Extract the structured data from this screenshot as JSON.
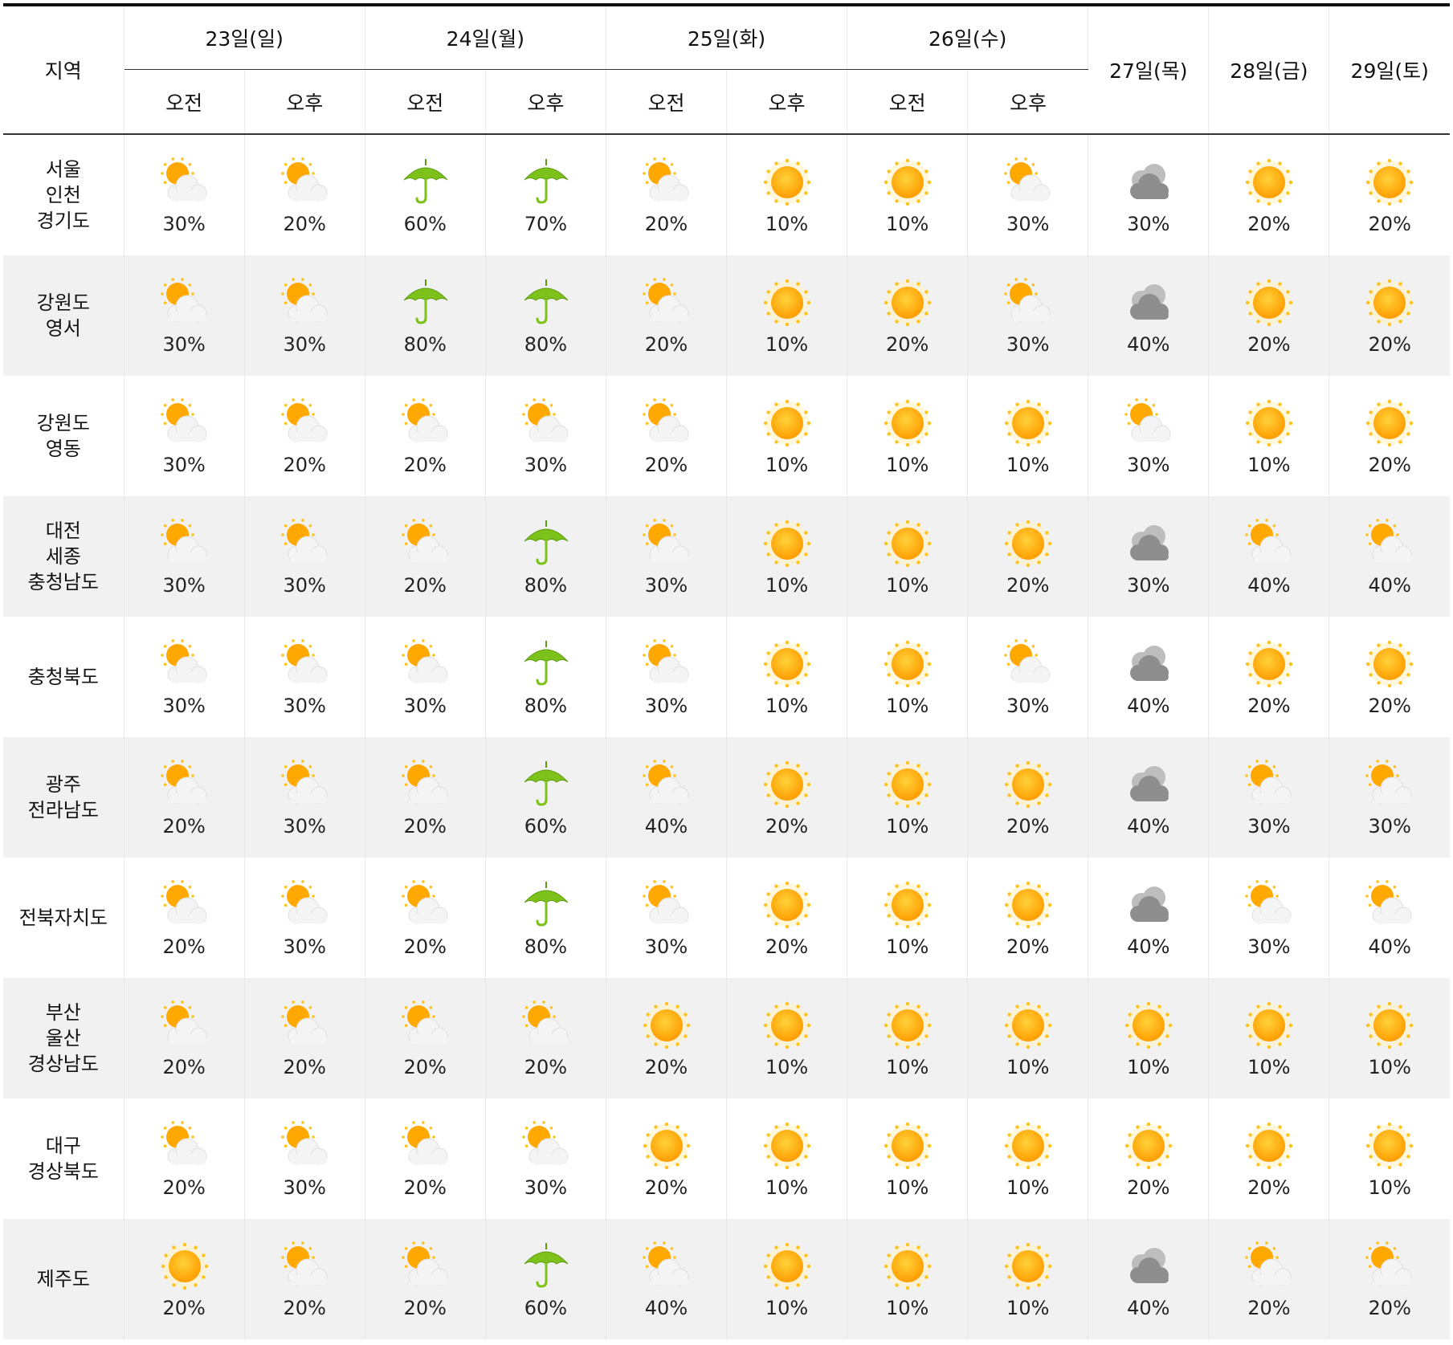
{
  "header": {
    "region_label": "지역",
    "days": [
      {
        "label": "23일(일)",
        "split": true
      },
      {
        "label": "24일(월)",
        "split": true
      },
      {
        "label": "25일(화)",
        "split": true
      },
      {
        "label": "26일(수)",
        "split": true
      },
      {
        "label": "27일(목)",
        "split": false
      },
      {
        "label": "28일(금)",
        "split": false
      },
      {
        "label": "29일(토)",
        "split": false
      }
    ],
    "am_label": "오전",
    "pm_label": "오후"
  },
  "icon_names": {
    "partly": "partly-cloudy-icon",
    "sun": "sun-icon",
    "umbrella": "umbrella-icon",
    "cloud": "cloudy-icon"
  },
  "colors": {
    "sun": "#ffa800",
    "umbrella": "#7cc21a",
    "cloud": "#9a9a9a",
    "alt_row": "#f1f1f1"
  },
  "rows": [
    {
      "region": [
        "서울",
        "인천",
        "경기도"
      ],
      "cells": [
        {
          "icon": "partly",
          "pct": "30%"
        },
        {
          "icon": "partly",
          "pct": "20%"
        },
        {
          "icon": "umbrella",
          "pct": "60%"
        },
        {
          "icon": "umbrella",
          "pct": "70%"
        },
        {
          "icon": "partly",
          "pct": "20%"
        },
        {
          "icon": "sun",
          "pct": "10%"
        },
        {
          "icon": "sun",
          "pct": "10%"
        },
        {
          "icon": "partly",
          "pct": "30%"
        },
        {
          "icon": "cloud",
          "pct": "30%"
        },
        {
          "icon": "sun",
          "pct": "20%"
        },
        {
          "icon": "sun",
          "pct": "20%"
        }
      ]
    },
    {
      "region": [
        "강원도",
        "영서"
      ],
      "cells": [
        {
          "icon": "partly",
          "pct": "30%"
        },
        {
          "icon": "partly",
          "pct": "30%"
        },
        {
          "icon": "umbrella",
          "pct": "80%"
        },
        {
          "icon": "umbrella",
          "pct": "80%"
        },
        {
          "icon": "partly",
          "pct": "20%"
        },
        {
          "icon": "sun",
          "pct": "10%"
        },
        {
          "icon": "sun",
          "pct": "20%"
        },
        {
          "icon": "partly",
          "pct": "30%"
        },
        {
          "icon": "cloud",
          "pct": "40%"
        },
        {
          "icon": "sun",
          "pct": "20%"
        },
        {
          "icon": "sun",
          "pct": "20%"
        }
      ]
    },
    {
      "region": [
        "강원도",
        "영동"
      ],
      "cells": [
        {
          "icon": "partly",
          "pct": "30%"
        },
        {
          "icon": "partly",
          "pct": "20%"
        },
        {
          "icon": "partly",
          "pct": "20%"
        },
        {
          "icon": "partly",
          "pct": "30%"
        },
        {
          "icon": "partly",
          "pct": "20%"
        },
        {
          "icon": "sun",
          "pct": "10%"
        },
        {
          "icon": "sun",
          "pct": "10%"
        },
        {
          "icon": "sun",
          "pct": "10%"
        },
        {
          "icon": "partly",
          "pct": "30%"
        },
        {
          "icon": "sun",
          "pct": "10%"
        },
        {
          "icon": "sun",
          "pct": "20%"
        }
      ]
    },
    {
      "region": [
        "대전",
        "세종",
        "충청남도"
      ],
      "cells": [
        {
          "icon": "partly",
          "pct": "30%"
        },
        {
          "icon": "partly",
          "pct": "30%"
        },
        {
          "icon": "partly",
          "pct": "20%"
        },
        {
          "icon": "umbrella",
          "pct": "80%"
        },
        {
          "icon": "partly",
          "pct": "30%"
        },
        {
          "icon": "sun",
          "pct": "10%"
        },
        {
          "icon": "sun",
          "pct": "10%"
        },
        {
          "icon": "sun",
          "pct": "20%"
        },
        {
          "icon": "cloud",
          "pct": "30%"
        },
        {
          "icon": "partly",
          "pct": "40%"
        },
        {
          "icon": "partly",
          "pct": "40%"
        }
      ]
    },
    {
      "region": [
        "충청북도"
      ],
      "cells": [
        {
          "icon": "partly",
          "pct": "30%"
        },
        {
          "icon": "partly",
          "pct": "30%"
        },
        {
          "icon": "partly",
          "pct": "30%"
        },
        {
          "icon": "umbrella",
          "pct": "80%"
        },
        {
          "icon": "partly",
          "pct": "30%"
        },
        {
          "icon": "sun",
          "pct": "10%"
        },
        {
          "icon": "sun",
          "pct": "10%"
        },
        {
          "icon": "partly",
          "pct": "30%"
        },
        {
          "icon": "cloud",
          "pct": "40%"
        },
        {
          "icon": "sun",
          "pct": "20%"
        },
        {
          "icon": "sun",
          "pct": "20%"
        }
      ]
    },
    {
      "region": [
        "광주",
        "전라남도"
      ],
      "cells": [
        {
          "icon": "partly",
          "pct": "20%"
        },
        {
          "icon": "partly",
          "pct": "30%"
        },
        {
          "icon": "partly",
          "pct": "20%"
        },
        {
          "icon": "umbrella",
          "pct": "60%"
        },
        {
          "icon": "partly",
          "pct": "40%"
        },
        {
          "icon": "sun",
          "pct": "20%"
        },
        {
          "icon": "sun",
          "pct": "10%"
        },
        {
          "icon": "sun",
          "pct": "20%"
        },
        {
          "icon": "cloud",
          "pct": "40%"
        },
        {
          "icon": "partly",
          "pct": "30%"
        },
        {
          "icon": "partly",
          "pct": "30%"
        }
      ]
    },
    {
      "region": [
        "전북자치도"
      ],
      "cells": [
        {
          "icon": "partly",
          "pct": "20%"
        },
        {
          "icon": "partly",
          "pct": "30%"
        },
        {
          "icon": "partly",
          "pct": "20%"
        },
        {
          "icon": "umbrella",
          "pct": "80%"
        },
        {
          "icon": "partly",
          "pct": "30%"
        },
        {
          "icon": "sun",
          "pct": "20%"
        },
        {
          "icon": "sun",
          "pct": "10%"
        },
        {
          "icon": "sun",
          "pct": "20%"
        },
        {
          "icon": "cloud",
          "pct": "40%"
        },
        {
          "icon": "partly",
          "pct": "30%"
        },
        {
          "icon": "partly",
          "pct": "40%"
        }
      ]
    },
    {
      "region": [
        "부산",
        "울산",
        "경상남도"
      ],
      "cells": [
        {
          "icon": "partly",
          "pct": "20%"
        },
        {
          "icon": "partly",
          "pct": "20%"
        },
        {
          "icon": "partly",
          "pct": "20%"
        },
        {
          "icon": "partly",
          "pct": "20%"
        },
        {
          "icon": "sun",
          "pct": "20%"
        },
        {
          "icon": "sun",
          "pct": "10%"
        },
        {
          "icon": "sun",
          "pct": "10%"
        },
        {
          "icon": "sun",
          "pct": "10%"
        },
        {
          "icon": "sun",
          "pct": "10%"
        },
        {
          "icon": "sun",
          "pct": "10%"
        },
        {
          "icon": "sun",
          "pct": "10%"
        }
      ]
    },
    {
      "region": [
        "대구",
        "경상북도"
      ],
      "cells": [
        {
          "icon": "partly",
          "pct": "20%"
        },
        {
          "icon": "partly",
          "pct": "30%"
        },
        {
          "icon": "partly",
          "pct": "20%"
        },
        {
          "icon": "partly",
          "pct": "30%"
        },
        {
          "icon": "sun",
          "pct": "20%"
        },
        {
          "icon": "sun",
          "pct": "10%"
        },
        {
          "icon": "sun",
          "pct": "10%"
        },
        {
          "icon": "sun",
          "pct": "10%"
        },
        {
          "icon": "sun",
          "pct": "20%"
        },
        {
          "icon": "sun",
          "pct": "20%"
        },
        {
          "icon": "sun",
          "pct": "10%"
        }
      ]
    },
    {
      "region": [
        "제주도"
      ],
      "cells": [
        {
          "icon": "sun",
          "pct": "20%"
        },
        {
          "icon": "partly",
          "pct": "20%"
        },
        {
          "icon": "partly",
          "pct": "20%"
        },
        {
          "icon": "umbrella",
          "pct": "60%"
        },
        {
          "icon": "partly",
          "pct": "40%"
        },
        {
          "icon": "sun",
          "pct": "10%"
        },
        {
          "icon": "sun",
          "pct": "10%"
        },
        {
          "icon": "sun",
          "pct": "10%"
        },
        {
          "icon": "cloud",
          "pct": "40%"
        },
        {
          "icon": "partly",
          "pct": "20%"
        },
        {
          "icon": "partly",
          "pct": "20%"
        }
      ]
    }
  ]
}
